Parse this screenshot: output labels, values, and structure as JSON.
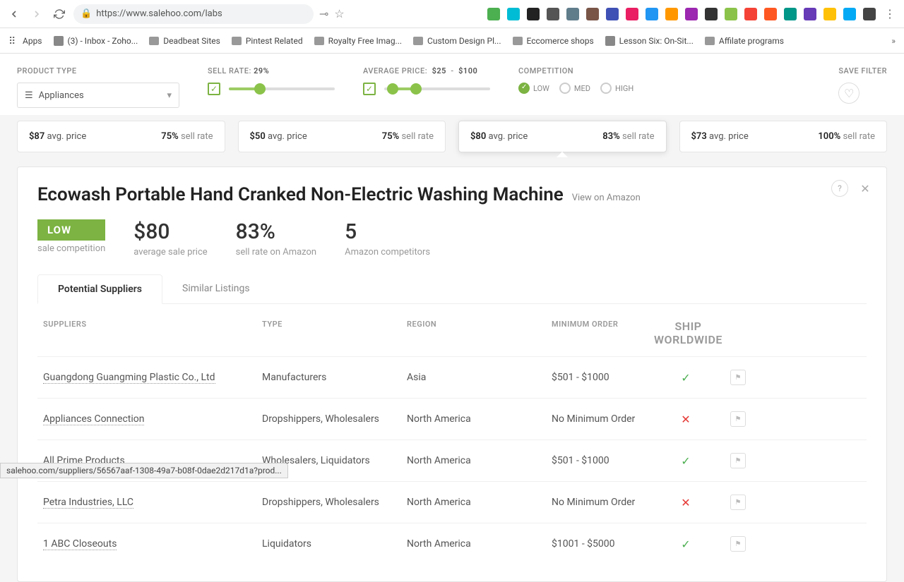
{
  "browser": {
    "url": "https://www.salehoo.com/labs",
    "bookmarks": [
      {
        "icon": "apps",
        "label": "Apps"
      },
      {
        "icon": "mail",
        "label": "(3) - Inbox - Zoho..."
      },
      {
        "icon": "folder",
        "label": "Deadbeat Sites"
      },
      {
        "icon": "folder",
        "label": "Pintest Related"
      },
      {
        "icon": "folder",
        "label": "Royalty Free Imag..."
      },
      {
        "icon": "folder",
        "label": "Custom Design Pl..."
      },
      {
        "icon": "folder",
        "label": "Eccomerce shops"
      },
      {
        "icon": "page",
        "label": "Lesson Six: On-Sit..."
      },
      {
        "icon": "folder",
        "label": "Affilate programs"
      }
    ],
    "ext_colors": [
      "#4caf50",
      "#00bcd4",
      "#222",
      "#555",
      "#607d8b",
      "#795548",
      "#3f51b5",
      "#e91e63",
      "#2196f3",
      "#ff9800",
      "#9c27b0",
      "#333",
      "#8bc34a",
      "#f44336",
      "#ff5722",
      "#009688",
      "#673ab7",
      "#ffc107",
      "#03a9f4",
      "#444"
    ]
  },
  "filters": {
    "product_type_label": "PRODUCT TYPE",
    "product_type_value": "Appliances",
    "sell_rate_label": "SELL RATE:",
    "sell_rate_value": "29%",
    "avg_price_label": "AVERAGE PRICE:",
    "avg_price_min": "$25",
    "avg_price_sep": "-",
    "avg_price_max": "$100",
    "competition_label": "COMPETITION",
    "comp_low": "LOW",
    "comp_med": "MED",
    "comp_high": "HIGH",
    "save_label": "SAVE FILTER"
  },
  "cards": [
    {
      "price": "$87",
      "price_lbl": "avg. price",
      "rate": "75%",
      "rate_lbl": "sell rate"
    },
    {
      "price": "$50",
      "price_lbl": "avg. price",
      "rate": "75%",
      "rate_lbl": "sell rate"
    },
    {
      "price": "$80",
      "price_lbl": "avg. price",
      "rate": "83%",
      "rate_lbl": "sell rate"
    },
    {
      "price": "$73",
      "price_lbl": "avg. price",
      "rate": "100%",
      "rate_lbl": "sell rate"
    }
  ],
  "detail": {
    "title": "Ecowash Portable Hand Cranked Non-Electric Washing Machine",
    "view_link": "View on Amazon",
    "badge": "LOW",
    "badge_sub": "sale competition",
    "price": "$80",
    "price_sub": "average sale price",
    "rate": "83%",
    "rate_sub": "sell rate on Amazon",
    "competitors": "5",
    "competitors_sub": "Amazon competitors",
    "tab1": "Potential Suppliers",
    "tab2": "Similar Listings"
  },
  "table": {
    "headers": {
      "suppliers": "SUPPLIERS",
      "type": "TYPE",
      "region": "REGION",
      "min": "MINIMUM ORDER",
      "ship": "SHIP WORLDWIDE"
    },
    "rows": [
      {
        "name": "Guangdong Guangming Plastic Co., Ltd",
        "type": "Manufacturers",
        "region": "Asia",
        "min": "$501 - $1000",
        "ship": true
      },
      {
        "name": "Appliances Connection",
        "type": "Dropshippers, Wholesalers",
        "region": "North America",
        "min": "No Minimum Order",
        "ship": false
      },
      {
        "name": "All Prime Products",
        "type": "Wholesalers, Liquidators",
        "region": "North America",
        "min": "$501 - $1000",
        "ship": true
      },
      {
        "name": "Petra Industries, LLC",
        "type": "Dropshippers, Wholesalers",
        "region": "North America",
        "min": "No Minimum Order",
        "ship": false
      },
      {
        "name": "1 ABC Closeouts",
        "type": "Liquidators",
        "region": "North America",
        "min": "$1001 - $5000",
        "ship": true
      }
    ]
  },
  "status_url": "salehoo.com/suppliers/56567aaf-1308-49a7-b08f-0dae2d217d1a?prod..."
}
